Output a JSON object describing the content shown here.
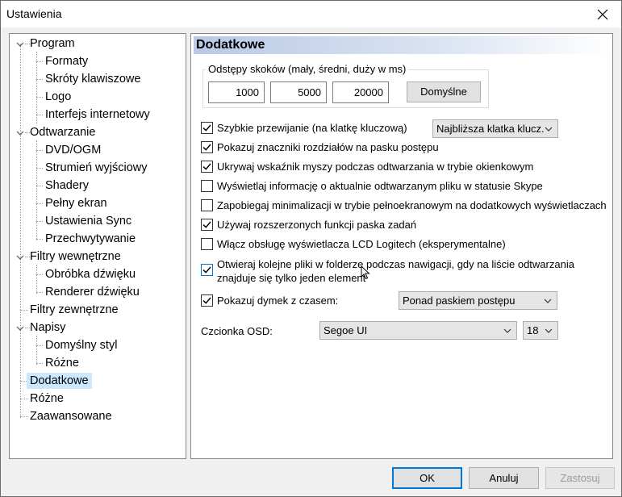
{
  "window": {
    "title": "Ustawienia"
  },
  "tree": {
    "items": [
      {
        "label": "Program"
      },
      {
        "label": "Formaty"
      },
      {
        "label": "Skróty klawiszowe"
      },
      {
        "label": "Logo"
      },
      {
        "label": "Interfejs internetowy"
      },
      {
        "label": "Odtwarzanie"
      },
      {
        "label": "DVD/OGM"
      },
      {
        "label": "Strumień wyjściowy"
      },
      {
        "label": "Shadery"
      },
      {
        "label": "Pełny ekran"
      },
      {
        "label": "Ustawienia Sync"
      },
      {
        "label": "Przechwytywanie"
      },
      {
        "label": "Filtry wewnętrzne"
      },
      {
        "label": "Obróbka dźwięku"
      },
      {
        "label": "Renderer dźwięku"
      },
      {
        "label": "Filtry zewnętrzne"
      },
      {
        "label": "Napisy"
      },
      {
        "label": "Domyślny styl"
      },
      {
        "label": "Różne"
      },
      {
        "label": "Dodatkowe"
      },
      {
        "label": "Różne"
      },
      {
        "label": "Zaawansowane"
      }
    ],
    "selected": "Dodatkowe"
  },
  "page": {
    "title": "Dodatkowe",
    "seek_group": {
      "label": "Odstępy skoków (mały, średni, duży w ms)",
      "small": "1000",
      "medium": "5000",
      "large": "20000",
      "default_button": "Domyślne"
    },
    "options": [
      {
        "label": "Szybkie przewijanie (na klatkę kluczową)",
        "checked": true
      },
      {
        "label": "Pokazuj znaczniki rozdziałów na pasku postępu",
        "checked": true
      },
      {
        "label": "Ukrywaj wskaźnik myszy podczas odtwarzania w trybie okienkowym",
        "checked": true
      },
      {
        "label": "Wyświetlaj informację o aktualnie odtwarzanym pliku w statusie Skype",
        "checked": false
      },
      {
        "label": "Zapobiegaj minimalizacji w trybie pełnoekranowym na dodatkowych wyświetlaczach",
        "checked": false
      },
      {
        "label": "Używaj rozszerzonych funkcji paska zadań",
        "checked": true
      },
      {
        "label": "Włącz obsługę wyświetlacza LCD Logitech (eksperymentalne)",
        "checked": false
      },
      {
        "label": "Otwieraj kolejne pliki w folderze podczas nawigacji, gdy na liście odtwarzania znajduje się tylko jeden element",
        "checked": true
      },
      {
        "label": "Pokazuj dymek z czasem:",
        "checked": true
      }
    ],
    "fast_seek_select": "Najbliższa klatka klucz.",
    "time_tooltip_select": "Ponad paskiem postępu",
    "osd_font_label": "Czcionka OSD:",
    "osd_font": "Segoe UI",
    "osd_size": "18"
  },
  "footer": {
    "ok": "OK",
    "cancel": "Anuluj",
    "apply": "Zastosuj"
  },
  "colors": {
    "selection": "#cce8ff",
    "accent": "#0078d7",
    "header_gradient": "#b9c9e6"
  }
}
